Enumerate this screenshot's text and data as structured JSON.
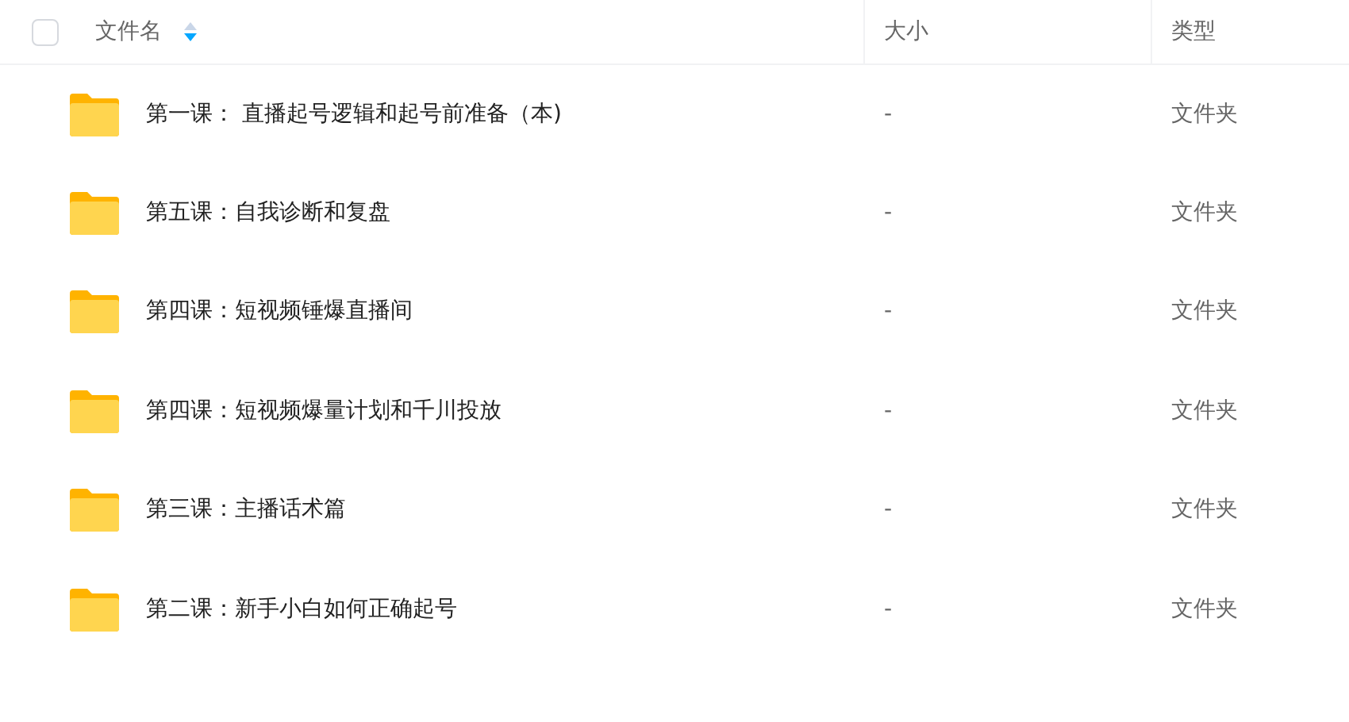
{
  "header": {
    "select_all": {
      "checked": false
    },
    "columns": [
      {
        "label": "文件名",
        "kind": "sortable"
      },
      {
        "label": "大小",
        "kind": "plain"
      },
      {
        "label": "类型",
        "kind": "plain"
      }
    ]
  },
  "rows": [
    {
      "name": "第一课： 直播起号逻辑和起号前准备（本)",
      "size": "-",
      "type": "文件夹"
    },
    {
      "name": "第五课：自我诊断和复盘",
      "size": "-",
      "type": "文件夹"
    },
    {
      "name": "第四课：短视频锤爆直播间",
      "size": "-",
      "type": "文件夹"
    },
    {
      "name": "第四课：短视频爆量计划和千川投放",
      "size": "-",
      "type": "文件夹"
    },
    {
      "name": "第三课：主播话术篇",
      "size": "-",
      "type": "文件夹"
    },
    {
      "name": "第二课：新手小白如何正确起号",
      "size": "-",
      "type": "文件夹"
    }
  ]
}
